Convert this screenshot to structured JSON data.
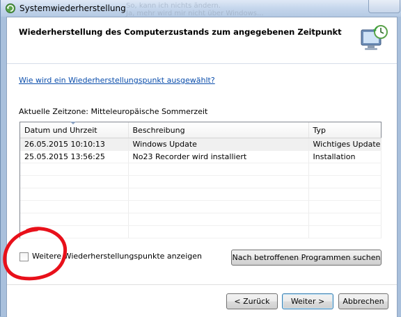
{
  "window": {
    "title": "Systemwiederherstellung",
    "background_text": "So, kann ich nichts ändern.\nJa, mehr wird mir nicht über Windows..."
  },
  "header": {
    "heading": "Wiederherstellung des Computerzustands zum angegebenen Zeitpunkt",
    "icon": "system-restore-monitor-icon"
  },
  "help_link": "Wie wird ein Wiederherstellungspunkt ausgewählt?",
  "timezone_label": "Aktuelle Zeitzone: Mitteleuropäische Sommerzeit",
  "table": {
    "columns": [
      "Datum und Uhrzeit",
      "Beschreibung",
      "Typ"
    ],
    "rows": [
      {
        "date": "26.05.2015 10:10:13",
        "description": "Windows Update",
        "type": "Wichtiges Update"
      },
      {
        "date": "25.05.2015 13:56:25",
        "description": "No23 Recorder wird installiert",
        "type": "Installation"
      }
    ]
  },
  "checkbox": {
    "label": "Weitere Wiederherstellungspunkte anzeigen",
    "checked": false
  },
  "buttons": {
    "scan": "Nach betroffenen Programmen suchen",
    "back": "< Zurück",
    "next": "Weiter >",
    "cancel": "Abbrechen"
  },
  "annotation": {
    "color": "#e8101a"
  }
}
